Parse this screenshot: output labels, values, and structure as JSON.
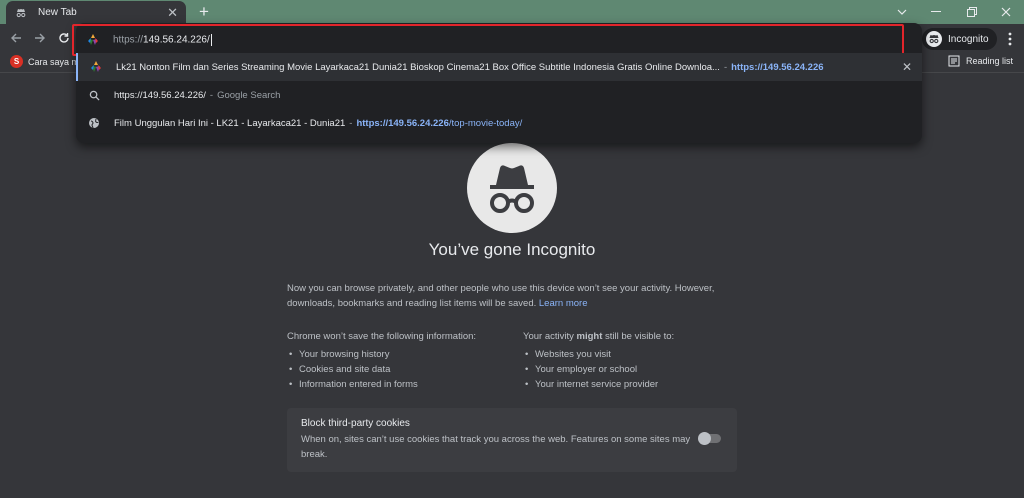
{
  "tab": {
    "title": "New Tab",
    "close": "✕"
  },
  "new_tab_label": "+",
  "window_controls": [
    "minimize",
    "maximize",
    "close"
  ],
  "profile": {
    "label": "Incognito"
  },
  "bookmarks": {
    "item": "Cara saya m",
    "reading_list": "Reading list"
  },
  "omnibox": {
    "value_prefix": "https://",
    "value_host": "149.56.24.226/"
  },
  "suggestions": [
    {
      "title": "Lk21 Nonton Film dan Series Streaming Movie Layarkaca21 Dunia21 Bioskop Cinema21 Box Office Subtitle Indonesia Gratis Online Downloa...",
      "sep": "-",
      "url": "https://149.56.24.226",
      "icon": "site-favicon",
      "removable": true
    },
    {
      "title": "https://149.56.24.226/",
      "sep": "-",
      "extra": "Google Search",
      "icon": "search-icon"
    },
    {
      "title": "Film Unggulan Hari Ini - LK21 - Layarkaca21 - Dunia21",
      "sep": "-",
      "url_bold": "https://149.56.24.226",
      "url_rest": "/top-movie-today/",
      "icon": "globe-icon"
    }
  ],
  "incognito": {
    "title": "You’ve gone Incognito",
    "intro": "Now you can browse privately, and other people who use this device won’t see your activity. However, downloads, bookmarks and reading list items will be saved.",
    "learn_more": "Learn more",
    "left_head": "Chrome won’t save the following information:",
    "left_items": [
      "Your browsing history",
      "Cookies and site data",
      "Information entered in forms"
    ],
    "right_head_a": "Your activity ",
    "right_head_b": "might",
    "right_head_c": " still be visible to:",
    "right_items": [
      "Websites you visit",
      "Your employer or school",
      "Your internet service provider"
    ],
    "cookie_title": "Block third-party cookies",
    "cookie_desc": "When on, sites can’t use cookies that track you across the web. Features on some sites may break.",
    "cookie_toggle": "off"
  },
  "colors": {
    "accent": "#8ab4f8",
    "highlight": "#e2252b",
    "frame": "#5f8872"
  }
}
